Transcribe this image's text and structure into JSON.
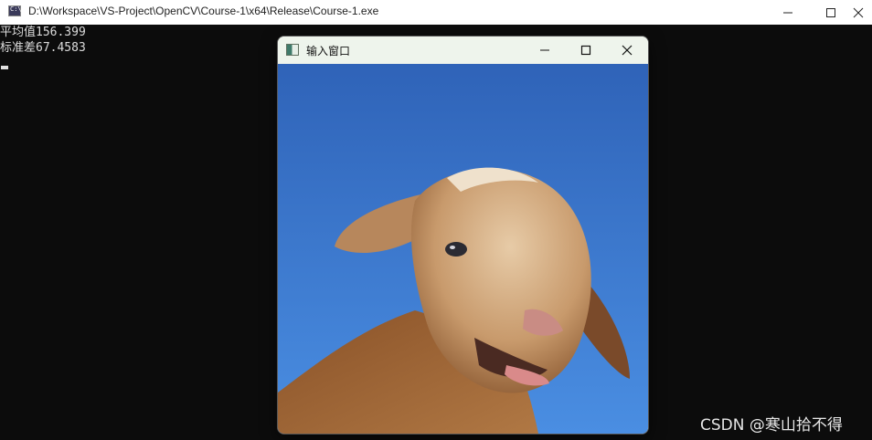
{
  "console": {
    "title": "D:\\Workspace\\VS-Project\\OpenCV\\Course-1\\x64\\Release\\Course-1.exe",
    "lines": [
      "平均值156.399",
      "标准差67.4583"
    ]
  },
  "image_window": {
    "title": "输入窗口",
    "image_subject": "sheep photo on blue sky background"
  },
  "watermark": "CSDN @寒山拾不得",
  "icons": {
    "minimize": "minimize-icon",
    "maximize": "maximize-icon",
    "close": "close-icon"
  },
  "colors": {
    "console_bg": "#0c0c0c",
    "console_text": "#dcdcdc",
    "sky": "#3d78d0",
    "wool": "#c89a6c"
  }
}
